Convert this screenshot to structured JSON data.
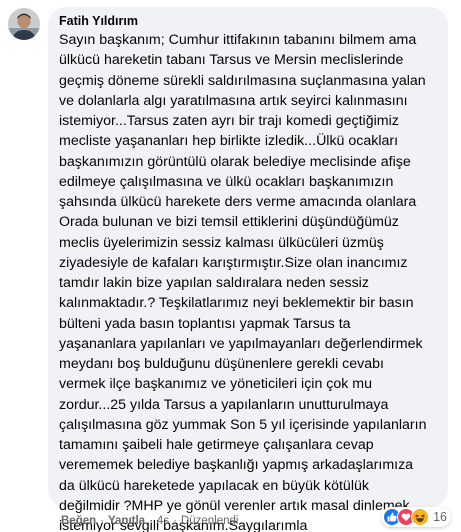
{
  "comment": {
    "author": "Fatih Yıldırım",
    "lines": [
      "Sayın başkanım; Cumhur ittifakının tabanını bilmem ama",
      "ülkücü hareketin tabanı Tarsus ve Mersin meclislerinde",
      "geçmiş döneme sürekli saldırılmasına suçlanmasına yalan",
      "ve dolanlarla algı yaratılmasına artık seyirci kalınmasını",
      "istemiyor...Tarsus zaten ayrı bir trajı komedi geçtiğimiz",
      "mecliste yaşananları hep birlikte izledik...Ülkü ocakları",
      "başkanımızın görüntülü olarak belediye meclisinde afişe",
      "edilmeye çalışılmasına ve ülkü ocakları başkanımızın",
      "şahsında ülkücü harekete ders verme amacında olanlara",
      "Orada bulunan ve bizi temsil ettiklerini düşündüğümüz",
      "meclis üyelerimizin sessiz kalması ülkücüleri üzmüş",
      "ziyadesiyle de kafaları karıştırmıştır.Size olan inancımız",
      "tamdır lakin bize yapılan saldıralara neden sessiz",
      "kalınmaktadır.? Teşkilatlarımız neyi beklemektir bir basın",
      "bülteni yada basın toplantısı yapmak Tarsus ta",
      "yaşananlara yapılanları ve yapılmayanları değerlendirmek",
      "meydanı boş bulduğunu düşünenlere gerekli cevabı",
      "vermek ilçe başkanımız ve yöneticileri için çok mu",
      "zordur...25 yılda Tarsus a yapılanların unutturulmaya",
      "çalışılmasına göz yummak Son 5 yıl içerisinde yapılanların",
      "tamamını şaibeli hale getirmeye çalışanlara cevap",
      "verememek belediye başkanlığı yapmış arkadaşlarımıza",
      "da ülkücü hareketede yapılacak en büyük kötülük",
      "değilmidir ?MHP ye gönül verenler artık masal dinlemek",
      "istemiyor sevgili başkanım.Saygılarımla"
    ]
  },
  "actions": {
    "like": "Beğen",
    "separator": "·",
    "reply": "Yanıtla",
    "time": "4s",
    "edited": "Düzenlendi"
  },
  "reactions": {
    "icons": [
      "like-icon",
      "love-icon",
      "haha-icon"
    ],
    "count": "16"
  },
  "colors": {
    "bubble": "#f0f2f5",
    "text": "#050505",
    "secondary": "#65676b",
    "like_blue": "#1877f2",
    "love_red": "#f33e58",
    "haha_yellow": "#f7b125"
  }
}
